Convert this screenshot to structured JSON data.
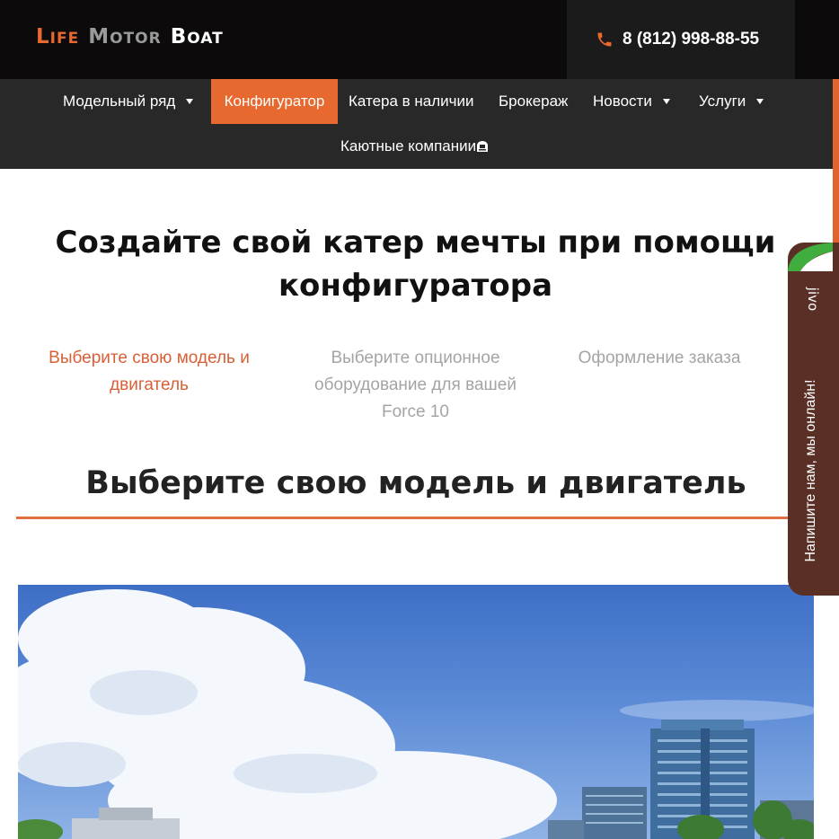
{
  "header": {
    "logo": {
      "word1": "Life",
      "word2": "Motor",
      "word3": "Boat"
    },
    "phone": "8 (812) 998-88-55"
  },
  "nav": {
    "items": [
      {
        "label": "Модельный ряд",
        "has_dropdown": true,
        "active": false
      },
      {
        "label": "Конфигуратор",
        "has_dropdown": false,
        "active": true
      },
      {
        "label": "Катера в наличии",
        "has_dropdown": false,
        "active": false
      },
      {
        "label": "Брокераж",
        "has_dropdown": false,
        "active": false
      },
      {
        "label": "Новости",
        "has_dropdown": true,
        "active": false
      },
      {
        "label": "Услуги",
        "has_dropdown": true,
        "active": false
      },
      {
        "label": "Каютные компании",
        "has_dropdown": false,
        "active": false
      }
    ],
    "second_row_item": "Каютные компании"
  },
  "main": {
    "headline": "Создайте свой катер мечты при помощи конфигуратора",
    "steps": [
      {
        "label": "Выберите свою модель и двигатель",
        "state": "active"
      },
      {
        "label": "Выберите опционное оборудование для вашей Force 10",
        "state": "inactive"
      },
      {
        "label": "Оформление заказа",
        "state": "inactive"
      }
    ],
    "section_title": "Выберите свою модель и двигатель"
  },
  "chat_widget": {
    "brand": "jivo",
    "message": "Напишите нам, мы онлайн!"
  },
  "colors": {
    "accent": "#e8692f",
    "header_bg": "#0c0a0a",
    "nav_bg": "#282828",
    "step_active": "#d95f36",
    "step_inactive": "#a4a4a4",
    "chat_bg": "#5a3026",
    "chat_leaf": "#3fae3f"
  },
  "icons": [
    "phone-icon",
    "cabin-icon",
    "caret-down-icon",
    "jivo-leaf-icon"
  ]
}
